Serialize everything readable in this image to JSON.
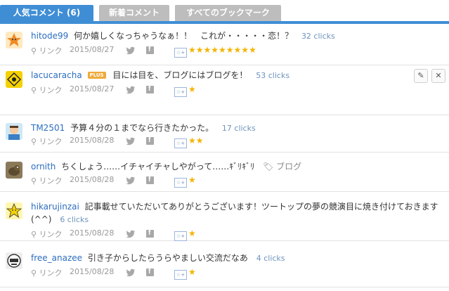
{
  "tabs": [
    {
      "label": "人気コメント (6)"
    },
    {
      "label": "新着コメント"
    },
    {
      "label": "すべてのブックマーク"
    }
  ],
  "meta_link_label": "リンク",
  "plus_badge": "PLUS",
  "items": [
    {
      "user": "hitode99",
      "comment": "何か嬉しくなっちゃうなぁ！！　これが・・・・・恋！？",
      "clicks": "32 clicks",
      "date": "2015/08/27",
      "stars": "★★★★★★★★★",
      "tag": ""
    },
    {
      "user": "lacucaracha",
      "comment": "目には目を、ブログにはブログを！",
      "clicks": "53 clicks",
      "date": "2015/08/27",
      "stars": "★",
      "tag": ""
    },
    {
      "user": "TM2501",
      "comment": "予算４分の１までなら行きたかった。",
      "clicks": "17 clicks",
      "date": "2015/08/28",
      "stars": "★★",
      "tag": ""
    },
    {
      "user": "ornith",
      "comment": "ちくしょう……イチャイチャしやがって……ｷﾞﾘｷﾞﾘ",
      "clicks": "",
      "date": "2015/08/28",
      "stars": "★",
      "tag": "ブログ"
    },
    {
      "user": "hikarujinzai",
      "comment": "記事載せていただいてありがとうございます！ツートップの夢の競演目に焼き付けておきます(^^)",
      "clicks": "6 clicks",
      "date": "2015/08/28",
      "stars": "★",
      "tag": ""
    },
    {
      "user": "free_anazee",
      "comment": "引き子からしたらうらやましい交流だなあ",
      "clicks": "4 clicks",
      "date": "2015/08/28",
      "stars": "★",
      "tag": ""
    }
  ],
  "colors": {
    "accent": "#3f8ed5",
    "tab_inactive": "#bdbdbd",
    "link": "#2c6dbf",
    "star": "#f4b400"
  }
}
